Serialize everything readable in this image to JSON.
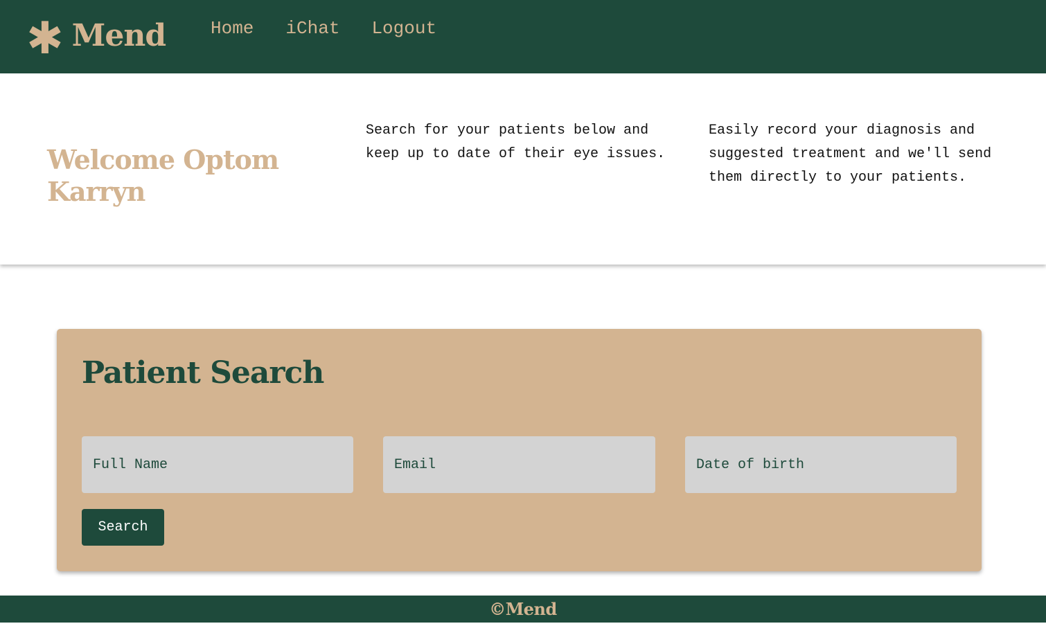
{
  "colors": {
    "primary": "#1e4a3b",
    "accent": "#d3b491",
    "input_bg": "#d3d3d3",
    "page_bg": "#ffffff"
  },
  "navbar": {
    "logo_icon": "asterisk-icon",
    "logo_glyph": "✱",
    "brand": "Mend",
    "links": [
      {
        "label": "Home"
      },
      {
        "label": "iChat"
      },
      {
        "label": "Logout"
      }
    ]
  },
  "hero": {
    "title": "Welcome Optom Karryn",
    "text_1": "Search for your patients below and keep up to date of their eye issues.",
    "text_2": "Easily record your diagnosis and suggested treatment and we'll send them directly to your patients."
  },
  "search": {
    "title": "Patient Search",
    "name_placeholder": "Full Name",
    "email_placeholder": "Email",
    "dob_placeholder": "Date of birth",
    "button_label": "Search"
  },
  "footer": {
    "text": "©Mend"
  }
}
